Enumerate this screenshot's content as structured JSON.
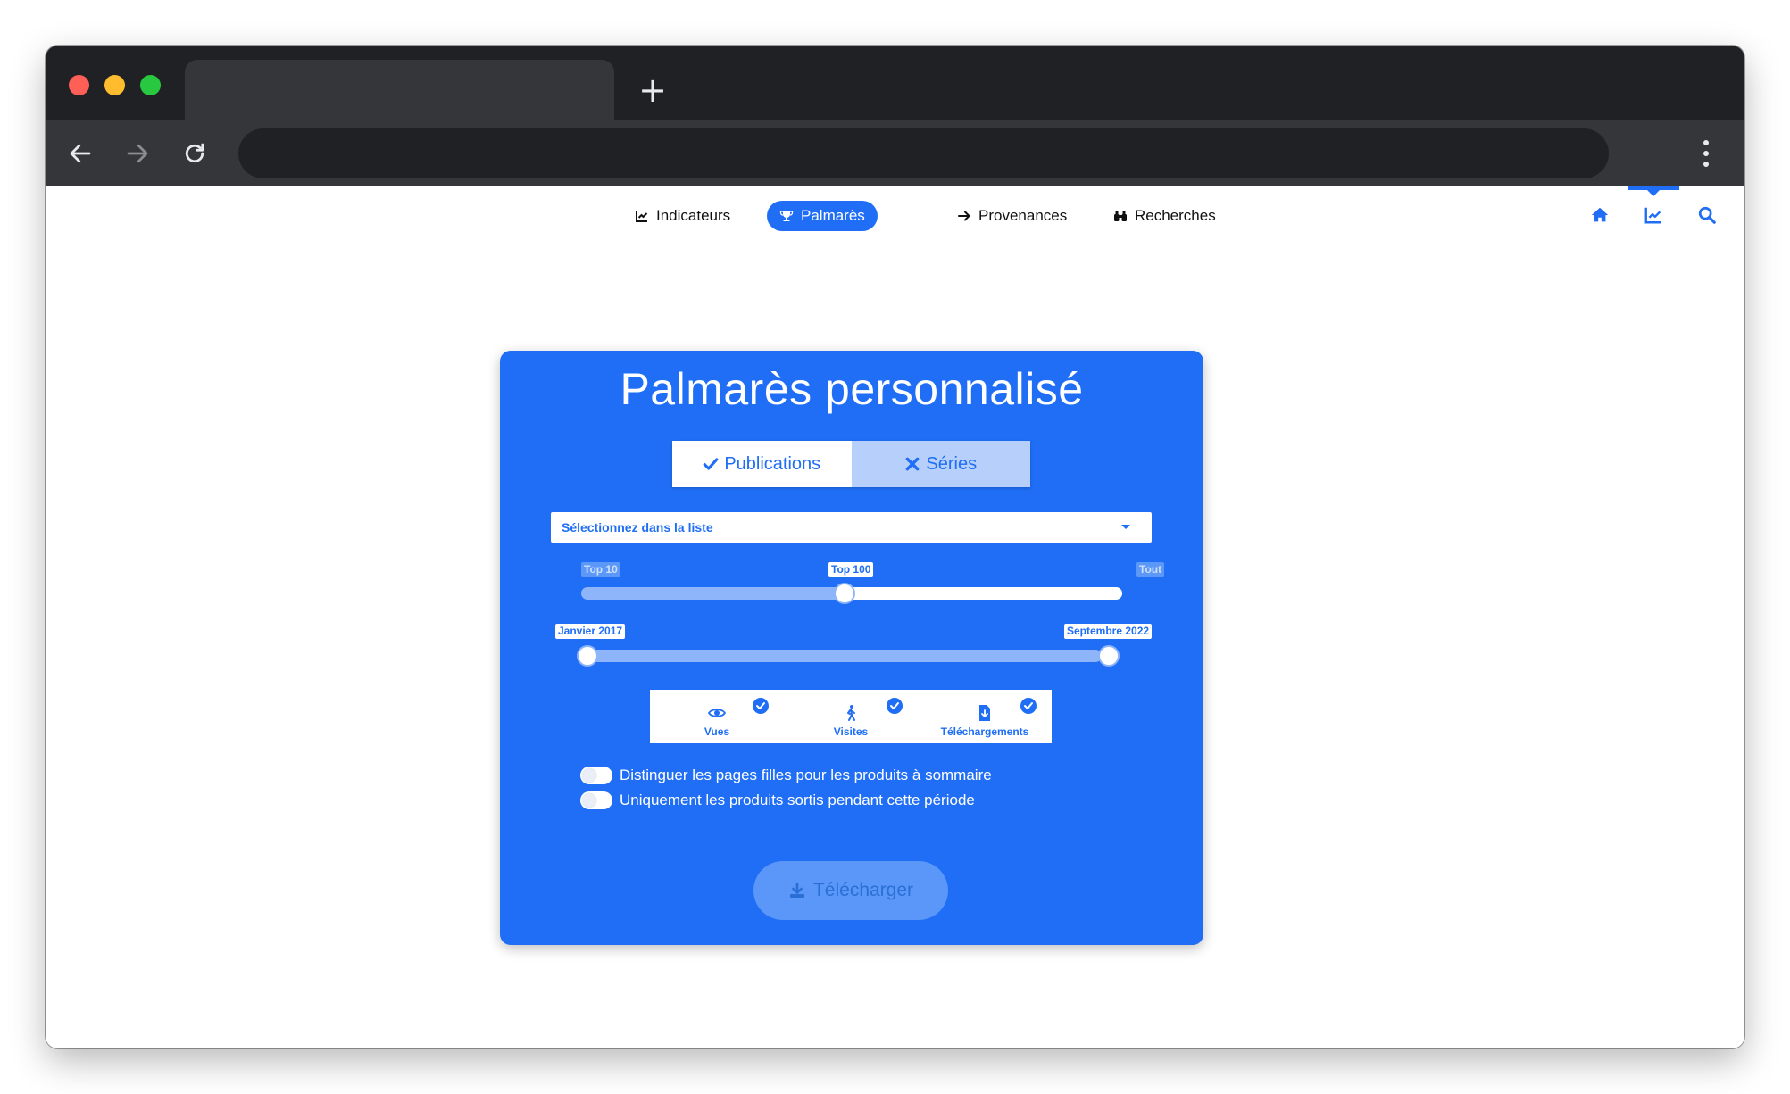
{
  "browser": {
    "tab_title": "",
    "address": "",
    "new_tab_label": "+"
  },
  "nav": {
    "items": [
      {
        "label": "Indicateurs",
        "icon": "line-chart-icon",
        "active": false
      },
      {
        "label": "Palmarès",
        "icon": "trophy-icon",
        "active": true
      },
      {
        "label": "Provenances",
        "icon": "arrow-right-icon",
        "active": false
      },
      {
        "label": "Recherches",
        "icon": "binoculars-icon",
        "active": false
      }
    ],
    "right_icons": [
      "home-icon",
      "line-chart-icon",
      "search-icon"
    ],
    "current_right_icon": "line-chart-icon"
  },
  "card": {
    "title": "Palmarès personnalisé",
    "segments": [
      {
        "label": "Publications",
        "icon": "check-icon",
        "selected": true
      },
      {
        "label": "Séries",
        "icon": "x-icon",
        "selected": false
      }
    ],
    "select": {
      "value": "Sélectionnez dans la liste"
    },
    "top_slider": {
      "labels": [
        "Top 10",
        "Top 100",
        "Tout"
      ],
      "selected": "Top 100",
      "value_fraction": 0.5
    },
    "date_slider": {
      "start": "Janvier 2017",
      "end": "Septembre 2022"
    },
    "metrics": [
      {
        "label": "Vues",
        "icon": "eye-icon",
        "checked": true
      },
      {
        "label": "Visites",
        "icon": "walking-icon",
        "checked": true
      },
      {
        "label": "Téléchargements",
        "icon": "file-download-icon",
        "checked": true
      }
    ],
    "toggles": [
      {
        "label": "Distinguer les pages filles pour les produits à sommaire",
        "on": false
      },
      {
        "label": "Uniquement les produits sortis pendant cette période",
        "on": false
      }
    ],
    "download_label": "Télécharger"
  },
  "colors": {
    "accent": "#1f6ef5",
    "titlebar": "#202124",
    "toolbar": "#35363a"
  }
}
